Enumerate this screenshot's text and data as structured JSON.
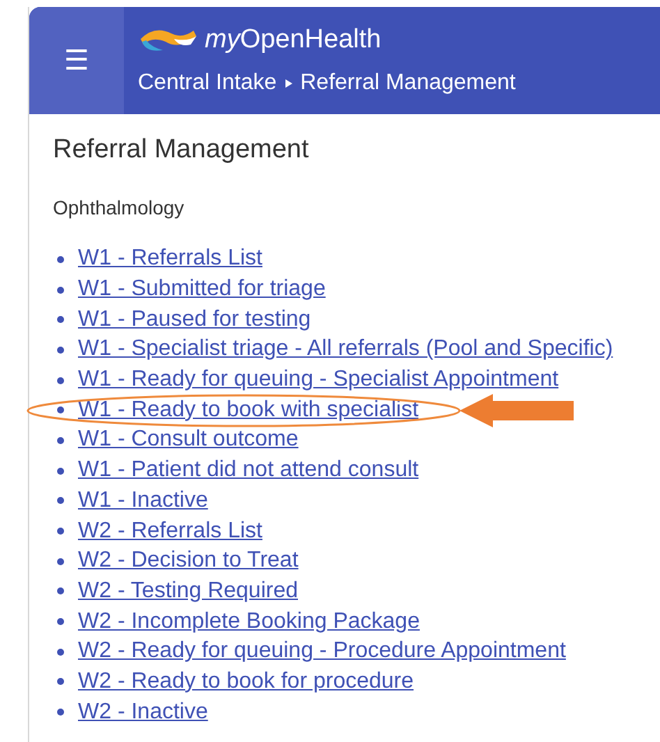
{
  "header": {
    "menu_icon": "☰",
    "brand_prefix": "my",
    "brand": "OpenHealth",
    "breadcrumb": [
      "Central Intake",
      "Referral Management"
    ]
  },
  "page_title": "Referral Management",
  "section": "Ophthalmology",
  "links": [
    {
      "label": "W1 - Referrals List",
      "highlighted": false
    },
    {
      "label": "W1 - Submitted for triage",
      "highlighted": false
    },
    {
      "label": "W1 - Paused for testing",
      "highlighted": false
    },
    {
      "label": "W1 - Specialist triage - All referrals (Pool and Specific)",
      "highlighted": false
    },
    {
      "label": "W1 - Ready for queuing - Specialist Appointment",
      "highlighted": false
    },
    {
      "label": "W1 - Ready to book with specialist",
      "highlighted": true
    },
    {
      "label": "W1 - Consult outcome",
      "highlighted": false
    },
    {
      "label": "W1 - Patient did not attend consult",
      "highlighted": false
    },
    {
      "label": "W1 - Inactive",
      "highlighted": false
    },
    {
      "label": "W2 - Referrals List",
      "highlighted": false
    },
    {
      "label": "W2 - Decision to Treat",
      "highlighted": false
    },
    {
      "label": "W2 - Testing Required",
      "highlighted": false
    },
    {
      "label": "W2 - Incomplete Booking Package",
      "highlighted": false
    },
    {
      "label": "W2 - Ready for queuing - Procedure Appointment",
      "highlighted": false
    },
    {
      "label": "W2 - Ready to book for procedure",
      "highlighted": false
    },
    {
      "label": "W2 - Inactive",
      "highlighted": false
    }
  ]
}
